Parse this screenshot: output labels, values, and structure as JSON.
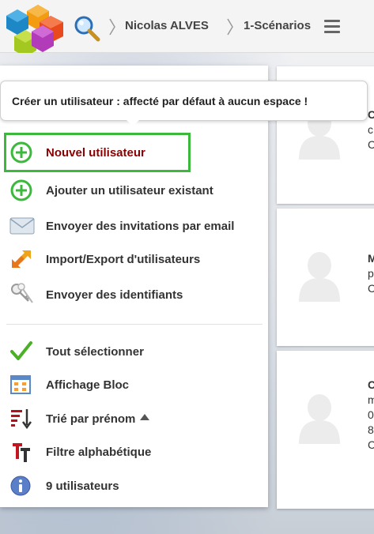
{
  "header": {
    "breadcrumb": [
      "Nicolas ALVES",
      "1-Scénarios"
    ]
  },
  "tooltip": {
    "text": "Créer un utilisateur : affecté par défaut à aucun espace !"
  },
  "menu": {
    "new_user": "Nouvel utilisateur",
    "add_existing": "Ajouter un utilisateur existant",
    "send_invites": "Envoyer des invitations par email",
    "import_export": "Import/Export d'utilisateurs",
    "send_credentials": "Envoyer des identifiants",
    "select_all": "Tout sélectionner",
    "display_block": "Affichage Bloc",
    "sort_by": "Trié par prénom",
    "alpha_filter": "Filtre alphabétique",
    "user_count": "9 utilisateurs"
  },
  "cards": [
    {
      "line1": "C",
      "line2": "c",
      "line3": "C"
    },
    {
      "line1": "M",
      "line2": "p",
      "line3": "C"
    },
    {
      "line1": "C",
      "line2": "m",
      "line3": "0",
      "line4": "8",
      "line5": "C"
    }
  ],
  "colors": {
    "accent_green": "#3cb93c",
    "new_user_text": "#8b0000"
  }
}
